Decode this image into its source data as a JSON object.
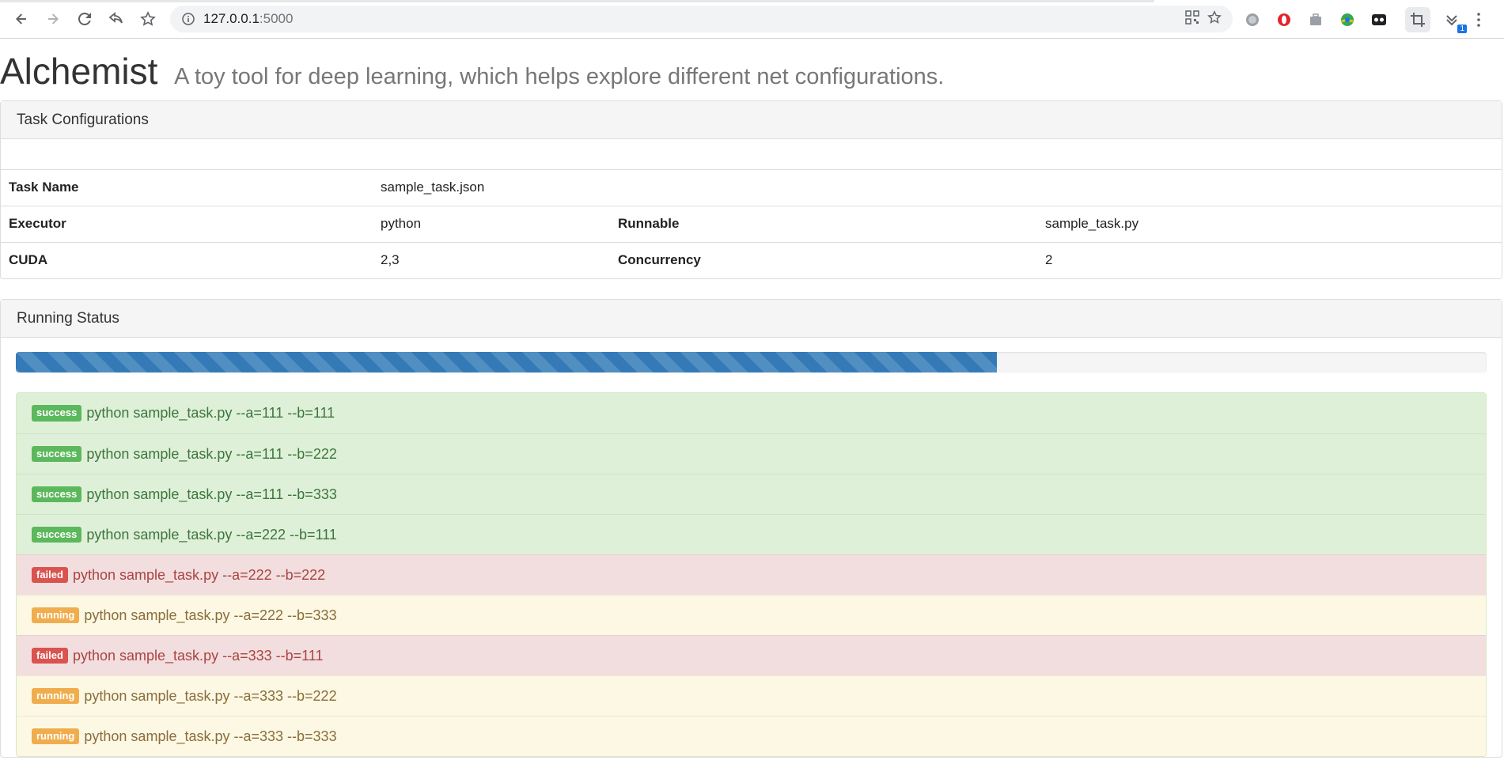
{
  "browser": {
    "url_host": "127.0.0.1",
    "url_port": ":5000",
    "notification_count": "1"
  },
  "page": {
    "title": "Alchemist",
    "subtitle": "A toy tool for deep learning, which helps explore different net configurations."
  },
  "config": {
    "heading": "Task Configurations",
    "task_name_label": "Task Name",
    "task_name_value": "sample_task.json",
    "executor_label": "Executor",
    "executor_value": "python",
    "runnable_label": "Runnable",
    "runnable_value": "sample_task.py",
    "cuda_label": "CUDA",
    "cuda_value": "2,3",
    "concurrency_label": "Concurrency",
    "concurrency_value": "2"
  },
  "status": {
    "heading": "Running Status",
    "progress_percent": 66.7,
    "tasks": [
      {
        "state": "success",
        "command": "python sample_task.py --a=111 --b=111"
      },
      {
        "state": "success",
        "command": "python sample_task.py --a=111 --b=222"
      },
      {
        "state": "success",
        "command": "python sample_task.py --a=111 --b=333"
      },
      {
        "state": "success",
        "command": "python sample_task.py --a=222 --b=111"
      },
      {
        "state": "failed",
        "command": "python sample_task.py --a=222 --b=222"
      },
      {
        "state": "running",
        "command": "python sample_task.py --a=222 --b=333"
      },
      {
        "state": "failed",
        "command": "python sample_task.py --a=333 --b=111"
      },
      {
        "state": "running",
        "command": "python sample_task.py --a=333 --b=222"
      },
      {
        "state": "running",
        "command": "python sample_task.py --a=333 --b=333"
      }
    ]
  },
  "colors": {
    "success": "#5cb85c",
    "failed": "#d9534f",
    "running": "#f0ad4e",
    "progress": "#337ab7"
  }
}
